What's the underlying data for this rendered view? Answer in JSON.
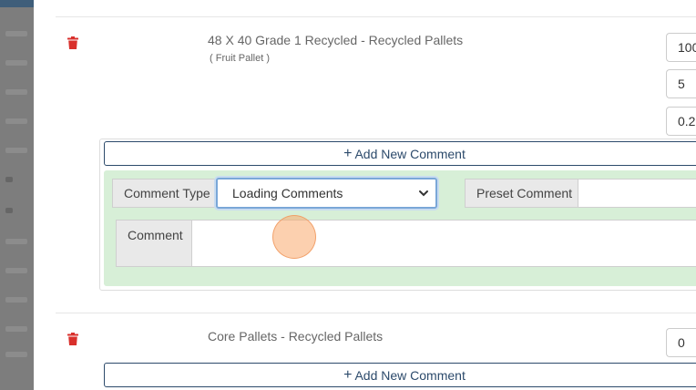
{
  "products": [
    {
      "name": "48 X 40 Grade 1 Recycled - Recycled Pallets",
      "subtitle": "( Fruit Pallet )",
      "inputs": [
        "100",
        "5",
        "0.2"
      ]
    },
    {
      "name": "Core Pallets - Recycled Pallets",
      "inputs": [
        "0"
      ]
    }
  ],
  "comments": {
    "add_label": "Add New Comment",
    "add_icon": "+",
    "type_label": "Comment Type",
    "type_value": "Loading Comments",
    "preset_label": "Preset Comment",
    "comment_label": "Comment"
  },
  "colors": {
    "trash": "#d9302c",
    "accent": "#2c4a6b",
    "comment_bg": "#d7efd7"
  }
}
